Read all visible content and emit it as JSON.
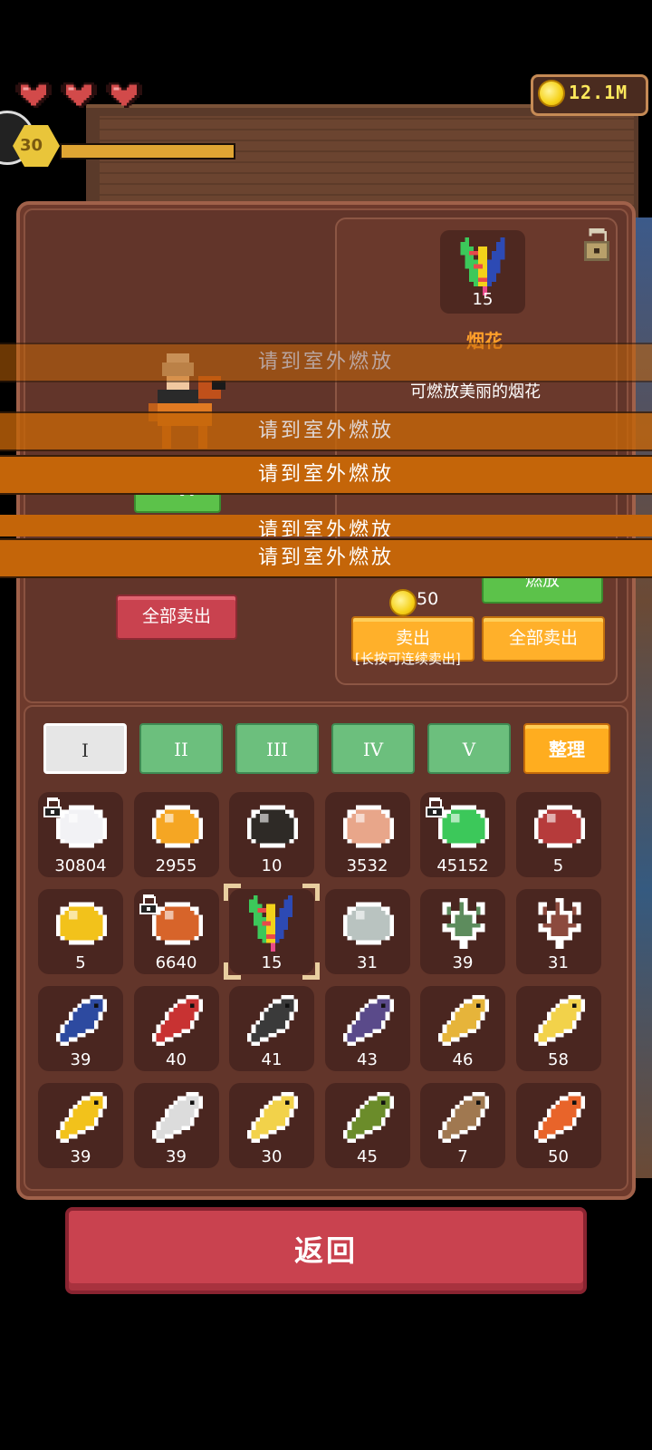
{
  "hud": {
    "hearts": 3,
    "level": "30",
    "xp_fraction": 1.0,
    "coins": "12.1M"
  },
  "character_panel": {
    "mount_button": "坐骑",
    "sell_all_button": "全部卖出"
  },
  "detail": {
    "count": "15",
    "name": "烟花",
    "description": "可燃放美丽的烟花",
    "use_button": "燃放",
    "price": "50",
    "sell_button": "卖出",
    "sell_all_button": "全部卖出",
    "hint": "[长按可连续卖出]"
  },
  "toasts": [
    {
      "text": "请到室外燃放"
    },
    {
      "text": "请到室外燃放"
    },
    {
      "text": "请到室外燃放"
    },
    {
      "text": "请到室外燃放"
    },
    {
      "text": "请到室外燃放"
    }
  ],
  "tabs": [
    {
      "label": "I",
      "selected": true
    },
    {
      "label": "II",
      "selected": false
    },
    {
      "label": "III",
      "selected": false
    },
    {
      "label": "IV",
      "selected": false
    },
    {
      "label": "V",
      "selected": false
    }
  ],
  "sort_button": "整理",
  "items": [
    {
      "name": "pearl-icon",
      "count": "30804",
      "locked": true
    },
    {
      "name": "orange-slices-icon",
      "count": "2955",
      "locked": false
    },
    {
      "name": "dark-shell-icon",
      "count": "10",
      "locked": false
    },
    {
      "name": "egg-icon",
      "count": "3532",
      "locked": false
    },
    {
      "name": "green-slime-icon",
      "count": "45152",
      "locked": true
    },
    {
      "name": "jar-icon",
      "count": "5",
      "locked": false
    },
    {
      "name": "yellow-slime-icon",
      "count": "5",
      "locked": false
    },
    {
      "name": "shrimp-icon",
      "count": "6640",
      "locked": true
    },
    {
      "name": "firework-icon",
      "count": "15",
      "locked": false,
      "selected": true
    },
    {
      "name": "grey-shell-icon",
      "count": "31",
      "locked": false
    },
    {
      "name": "green-seaweed-icon",
      "count": "39",
      "locked": false
    },
    {
      "name": "red-seaweed-icon",
      "count": "31",
      "locked": false
    },
    {
      "name": "blue-fish-icon",
      "count": "39",
      "locked": false
    },
    {
      "name": "red-fish-icon",
      "count": "40",
      "locked": false
    },
    {
      "name": "striped-fish-icon",
      "count": "41",
      "locked": false
    },
    {
      "name": "purple-fish-icon",
      "count": "43",
      "locked": false
    },
    {
      "name": "yellow-fish-icon",
      "count": "46",
      "locked": false
    },
    {
      "name": "gold-fish-icon",
      "count": "58",
      "locked": false
    },
    {
      "name": "golden-fish-icon",
      "count": "39",
      "locked": false
    },
    {
      "name": "white-fish-icon",
      "count": "39",
      "locked": false
    },
    {
      "name": "yellow-white-fish-icon",
      "count": "30",
      "locked": false
    },
    {
      "name": "green-fish-icon",
      "count": "45",
      "locked": false
    },
    {
      "name": "brown-fish-icon",
      "count": "7",
      "locked": false
    },
    {
      "name": "clownfish-icon",
      "count": "50",
      "locked": false
    }
  ],
  "item_colors": [
    "#f2f2f5",
    "#f5a623",
    "#2e2a26",
    "#e8a68a",
    "#3cc85a",
    "#b63b3b",
    "#f2c21b",
    "#d7642a",
    "#7fd14a",
    "#b9c3c0",
    "#5d8c5d",
    "#8c4a3e",
    "#2d4aa0",
    "#c83232",
    "#3a3a3a",
    "#5a4a8a",
    "#e6b43a",
    "#f2d24a",
    "#f2c21b",
    "#dcdcdc",
    "#f2d24a",
    "#6b8c2a",
    "#a07850",
    "#e8642a"
  ],
  "back_button": "返回"
}
